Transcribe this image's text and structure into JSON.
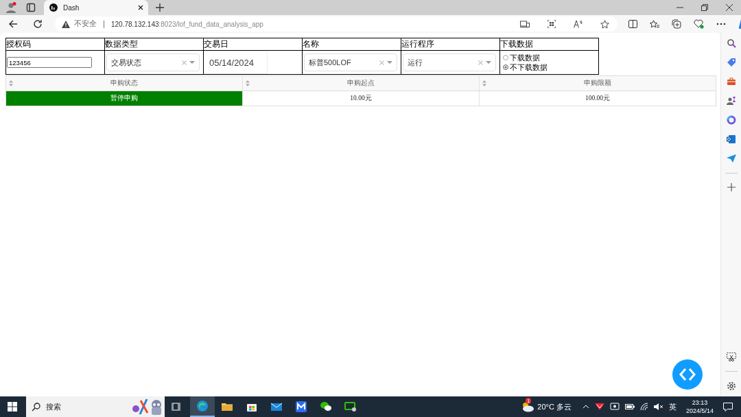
{
  "browser": {
    "tabs": [
      {
        "title": "Dash",
        "selected": true
      }
    ],
    "address": {
      "security": "不安全",
      "host": "120.78.132.143",
      "path": ":8023/lof_fund_data_analysis_app"
    }
  },
  "controls": [
    {
      "label": "授权码",
      "kind": "input",
      "value": "123456"
    },
    {
      "label": "数据类型",
      "kind": "dropdown",
      "value": "交易状态"
    },
    {
      "label": "交易日",
      "kind": "date",
      "value": "05/14/2024"
    },
    {
      "label": "名称",
      "kind": "dropdown",
      "value": "标普500LOF"
    },
    {
      "label": "运行程序",
      "kind": "dropdown",
      "value": "运行"
    },
    {
      "label": "下载数据",
      "kind": "radio",
      "options": [
        {
          "label": "下载数据",
          "selected": false
        },
        {
          "label": "不下载数据",
          "selected": true
        }
      ]
    }
  ],
  "table": {
    "columns": [
      "申购状态",
      "申购起点",
      "申购限额"
    ],
    "rows": [
      {
        "cells": [
          {
            "text": "暂停申购",
            "color": "#008000"
          },
          {
            "text": "10.00元"
          },
          {
            "text": "100.00元"
          }
        ]
      }
    ]
  },
  "taskbar": {
    "search": "搜索",
    "weather_badge": "1",
    "weather": "20°C 多云",
    "ime": "英",
    "time": "23:13",
    "date": "2024/5/14"
  }
}
